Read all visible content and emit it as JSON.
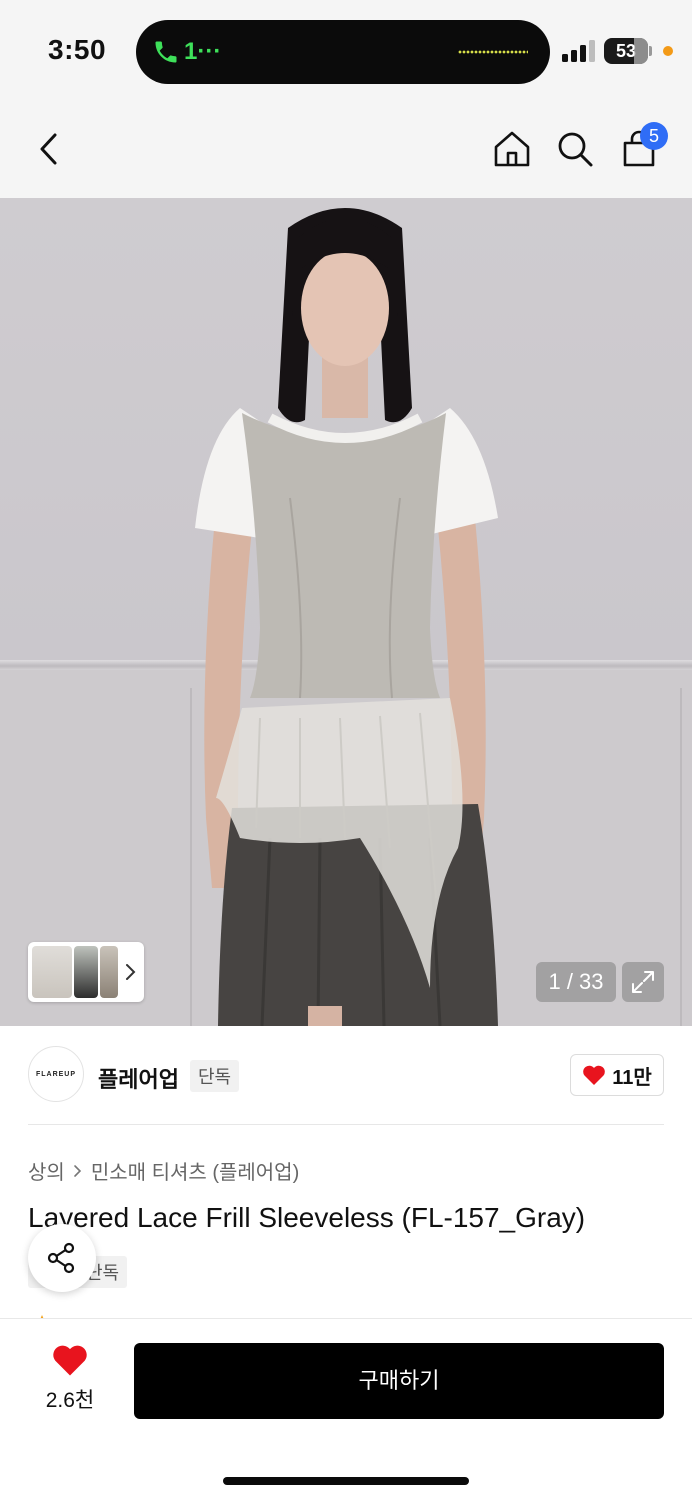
{
  "status_bar": {
    "time": "3:50",
    "call_text": "1···",
    "battery": "53"
  },
  "nav": {
    "cart_count": "5"
  },
  "gallery": {
    "counter": "1 / 33"
  },
  "brand": {
    "logo_text": "FLAREUP",
    "name": "플레어업",
    "tag": "단독",
    "likes": "11만"
  },
  "product": {
    "breadcrumb": [
      "상의",
      "민소매 티셔츠 (플레어업)"
    ],
    "title": "Layered Lace Frill Sleeveless (FL-157_Gray)",
    "exclusive_tag": "단독"
  },
  "bottom_bar": {
    "wish_count": "2.6천",
    "buy_label": "구매하기"
  },
  "colors": {
    "accent_red": "#e8141e",
    "badge_blue": "#2f6df6",
    "buy_button": "#000000"
  }
}
